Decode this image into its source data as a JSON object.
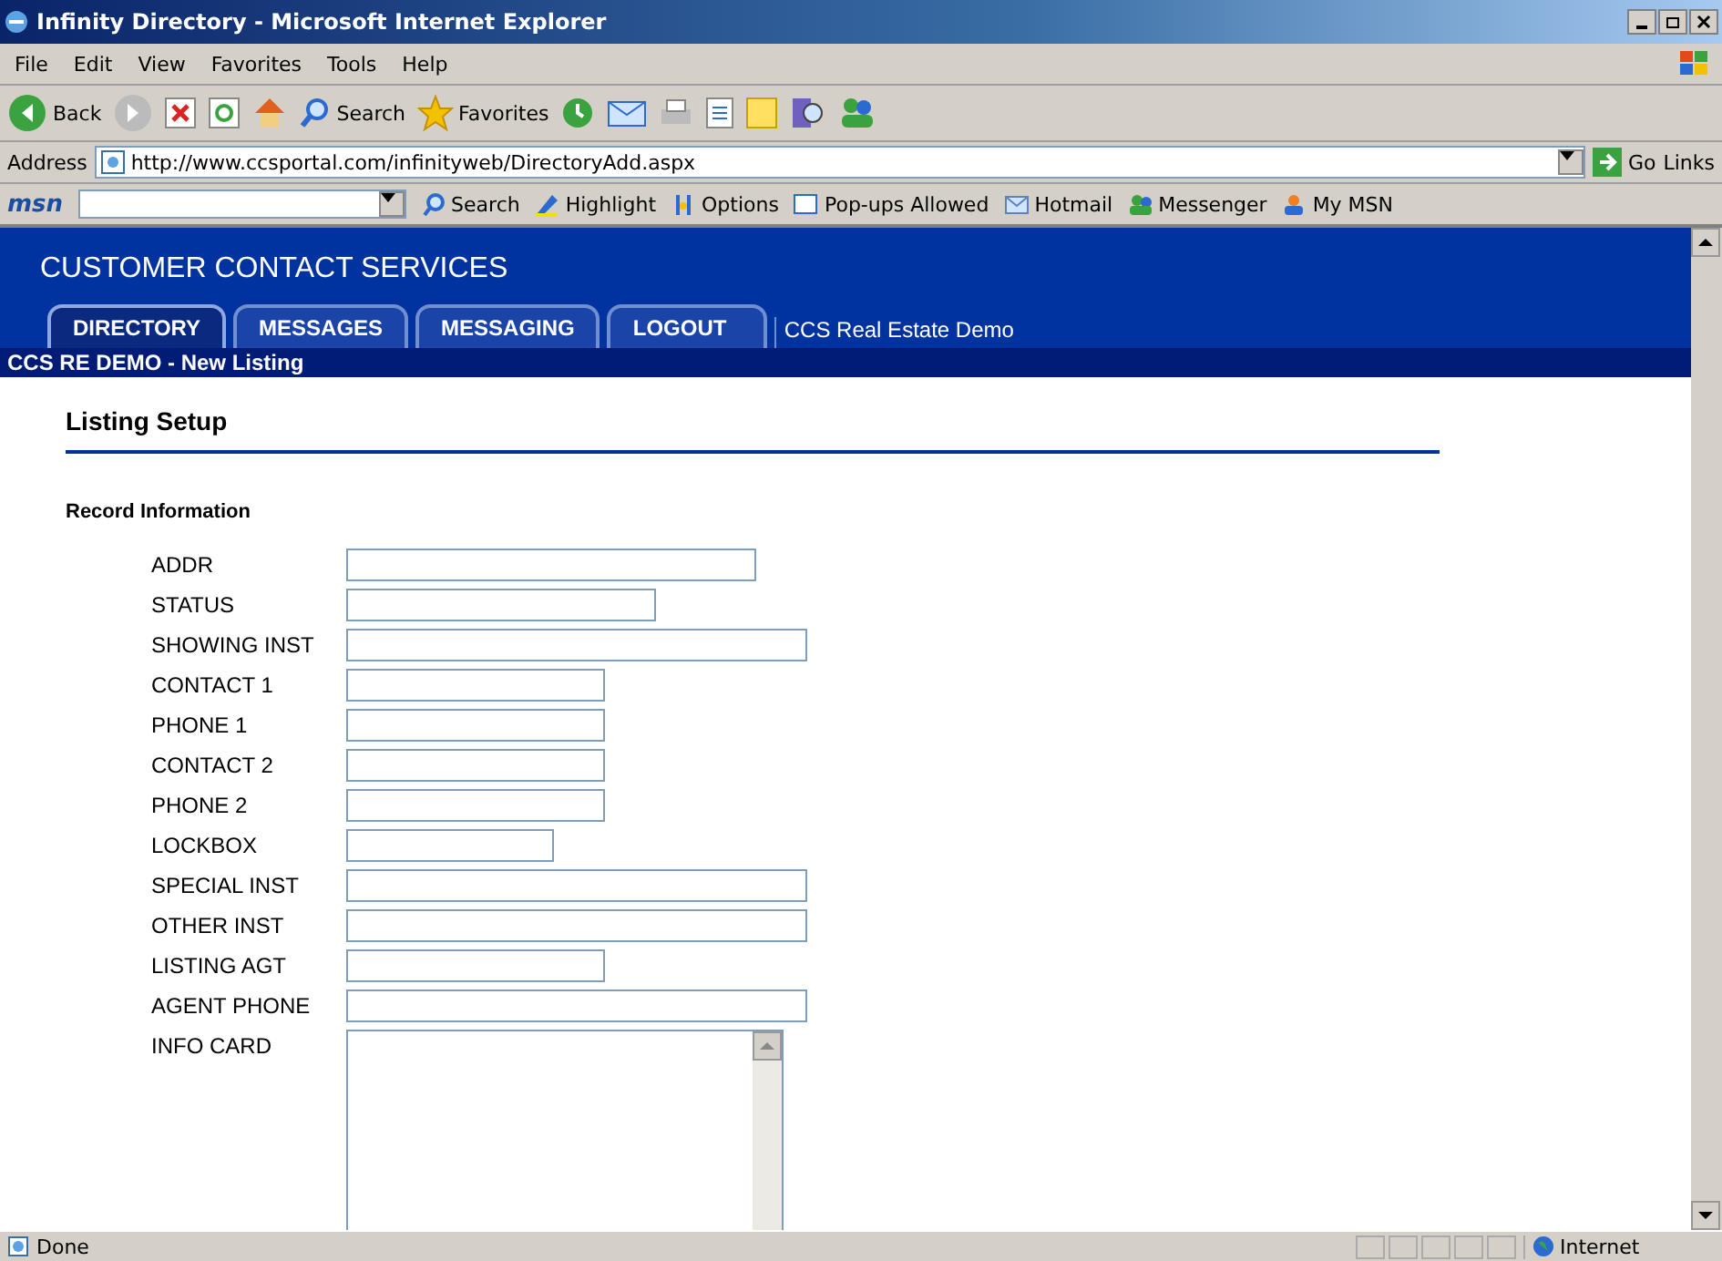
{
  "window": {
    "title": "Infinity Directory - Microsoft Internet Explorer"
  },
  "menu": [
    "File",
    "Edit",
    "View",
    "Favorites",
    "Tools",
    "Help"
  ],
  "toolbar": {
    "back": "Back",
    "search": "Search",
    "favorites": "Favorites"
  },
  "address_bar": {
    "label": "Address",
    "url": "http://www.ccsportal.com/infinityweb/DirectoryAdd.aspx",
    "go": "Go",
    "links": "Links"
  },
  "msn_bar": {
    "logo": "msn",
    "items": [
      {
        "label": "Search",
        "kind": "search"
      },
      {
        "label": "Highlight",
        "kind": "highlight"
      },
      {
        "label": "Options",
        "kind": "options"
      },
      {
        "label": "Pop-ups Allowed",
        "kind": "popups"
      },
      {
        "label": "Hotmail",
        "kind": "mail"
      },
      {
        "label": "Messenger",
        "kind": "messenger"
      },
      {
        "label": "My MSN",
        "kind": "mymsn"
      }
    ]
  },
  "page": {
    "brand": "CUSTOMER CONTACT SERVICES",
    "tabs": [
      {
        "label": "DIRECTORY",
        "selected": true
      },
      {
        "label": "MESSAGES",
        "selected": false
      },
      {
        "label": "MESSAGING",
        "selected": false
      },
      {
        "label": "LOGOUT",
        "selected": false
      }
    ],
    "account": "CCS Real Estate Demo",
    "breadcrumb": "CCS RE DEMO - New Listing",
    "heading": "Listing Setup",
    "section": "Record Information",
    "fields": [
      {
        "label": "ADDR",
        "kind": "text"
      },
      {
        "label": "STATUS",
        "kind": "text"
      },
      {
        "label": "SHOWING INST",
        "kind": "text"
      },
      {
        "label": "CONTACT 1",
        "kind": "text"
      },
      {
        "label": "PHONE 1",
        "kind": "text"
      },
      {
        "label": "CONTACT 2",
        "kind": "text"
      },
      {
        "label": "PHONE 2",
        "kind": "text"
      },
      {
        "label": "LOCKBOX",
        "kind": "text"
      },
      {
        "label": "SPECIAL INST",
        "kind": "text"
      },
      {
        "label": "OTHER INST",
        "kind": "text"
      },
      {
        "label": "LISTING AGT",
        "kind": "text"
      },
      {
        "label": "AGENT PHONE",
        "kind": "text"
      },
      {
        "label": "INFO CARD",
        "kind": "textarea"
      }
    ]
  },
  "status_bar": {
    "text": "Done",
    "zone": "Internet"
  }
}
